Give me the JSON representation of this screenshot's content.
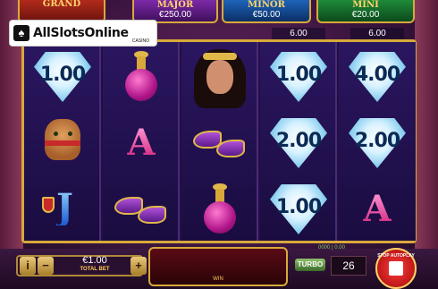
{
  "jackpots": [
    {
      "name": "GRAND",
      "value": ""
    },
    {
      "name": "MAJOR",
      "value": "€250.00"
    },
    {
      "name": "MINOR",
      "value": "€50.00"
    },
    {
      "name": "MINI",
      "value": "€20.00"
    }
  ],
  "logo": {
    "text": "AllSlotsOnline",
    "sub": "CASINO"
  },
  "reel_wins": [
    "6.00",
    "6.00"
  ],
  "reels": [
    [
      "diamond:1.00",
      "camel",
      "J"
    ],
    [
      "bottle",
      "A",
      "slippers"
    ],
    [
      "princess",
      "slippers",
      "bottle"
    ],
    [
      "diamond:1.00",
      "diamond:2.00",
      "diamond:1.00"
    ],
    [
      "diamond:4.00",
      "diamond:2.00",
      "A"
    ]
  ],
  "bottom": {
    "info_label": "i",
    "minus_label": "−",
    "plus_label": "+",
    "bet_value": "€1.00",
    "bet_label": "TOTAL BET",
    "win_label": "WIN",
    "small_counter": "0000 | 0.00",
    "turbo_label": "TURBO",
    "spins_left": "26",
    "stop_label": "STOP AUTOPLAY"
  }
}
